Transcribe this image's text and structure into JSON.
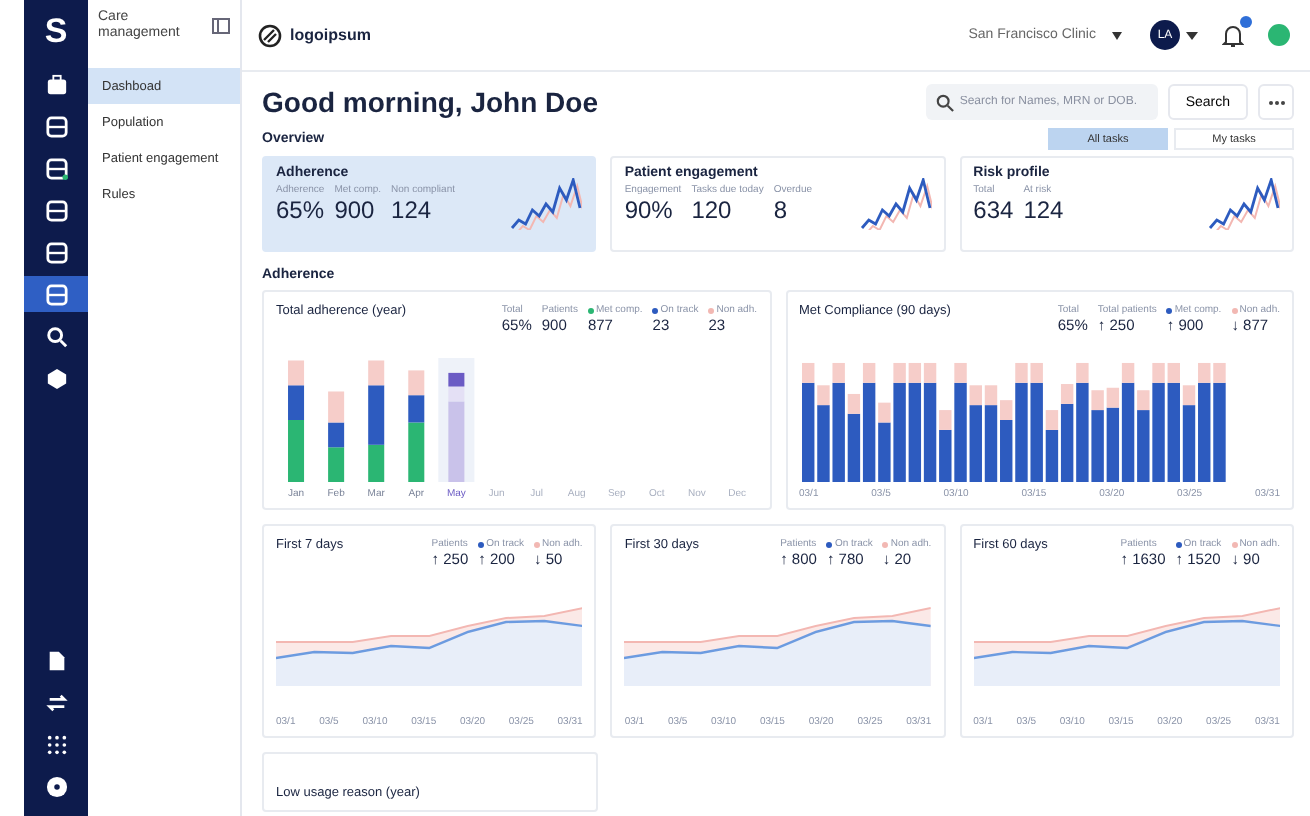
{
  "rail": {
    "logo": "S",
    "top_items": [
      {
        "selected": false
      },
      {
        "selected": false
      },
      {
        "selected": false
      },
      {
        "selected": false
      },
      {
        "selected": false
      },
      {
        "selected": true
      },
      {
        "selected": false
      },
      {
        "selected": false
      }
    ]
  },
  "nav": {
    "title": "Care management",
    "items": [
      {
        "label": "Dashboad",
        "selected": true
      },
      {
        "label": "Population",
        "selected": false
      },
      {
        "label": "Patient engagement",
        "selected": false
      },
      {
        "label": "Rules",
        "selected": false
      }
    ]
  },
  "topbar": {
    "brand": "logoipsum",
    "clinic": "San Francisco Clinic",
    "avatar": "LA",
    "notification": true
  },
  "header": {
    "greeting": "Good morning, John Doe",
    "search_placeholder": "Search for Names, MRN or DOB.",
    "search_button": "Search"
  },
  "overview": {
    "label": "Overview",
    "tabs": [
      {
        "label": "All tasks",
        "selected": true
      },
      {
        "label": "My tasks",
        "selected": false
      }
    ],
    "cards": [
      {
        "title": "Adherence",
        "selected": true,
        "stats": [
          {
            "label": "Adherence",
            "value": "65%"
          },
          {
            "label": "Met comp.",
            "value": "900"
          },
          {
            "label": "Non compliant",
            "value": "124"
          }
        ]
      },
      {
        "title": "Patient engagement",
        "selected": false,
        "stats": [
          {
            "label": "Engagement",
            "value": "90%"
          },
          {
            "label": "Tasks due today",
            "value": "120"
          },
          {
            "label": "Overdue",
            "value": "8"
          }
        ]
      },
      {
        "title": "Risk profile",
        "selected": false,
        "stats": [
          {
            "label": "Total",
            "value": "634"
          },
          {
            "label": "At risk",
            "value": "124"
          }
        ]
      }
    ]
  },
  "adherence": {
    "label": "Adherence",
    "total_chart": {
      "title": "Total adherence (year)",
      "stats": [
        {
          "label": "Total",
          "value": "65%"
        },
        {
          "label": "Patients",
          "value": "900"
        },
        {
          "label": "Met comp.",
          "value": "877",
          "color": "#2bb673"
        },
        {
          "label": "On track",
          "value": "23",
          "color": "#2d5bbf"
        },
        {
          "label": "Non adh.",
          "value": "23",
          "color": "#f2b8b3"
        }
      ],
      "months": [
        {
          "label": "Jan",
          "faded": false,
          "selected": false
        },
        {
          "label": "Feb",
          "faded": false,
          "selected": false
        },
        {
          "label": "Mar",
          "faded": false,
          "selected": false
        },
        {
          "label": "Apr",
          "faded": false,
          "selected": false
        },
        {
          "label": "May",
          "faded": false,
          "selected": true
        },
        {
          "label": "Jun",
          "faded": true,
          "selected": false
        },
        {
          "label": "Jul",
          "faded": true,
          "selected": false
        },
        {
          "label": "Aug",
          "faded": true,
          "selected": false
        },
        {
          "label": "Sep",
          "faded": true,
          "selected": false
        },
        {
          "label": "Oct",
          "faded": true,
          "selected": false
        },
        {
          "label": "Nov",
          "faded": true,
          "selected": false
        },
        {
          "label": "Dec",
          "faded": true,
          "selected": false
        }
      ]
    },
    "compliance_chart": {
      "title": "Met Compliance (90 days)",
      "stats": [
        {
          "label": "Total",
          "value": "65%"
        },
        {
          "label": "Total patients",
          "value": "↑ 250"
        },
        {
          "label": "Met comp.",
          "value": "↑ 900",
          "color": "#2d5bbf"
        },
        {
          "label": "Non adh.",
          "value": "↓ 877",
          "color": "#f2b8b3"
        }
      ],
      "dates": [
        "03/1",
        "03/5",
        "03/10",
        "03/15",
        "03/20",
        "03/25",
        "03/31"
      ]
    },
    "line_charts": [
      {
        "title": "First 7 days",
        "stats": [
          {
            "label": "Patients",
            "value": "↑ 250"
          },
          {
            "label": "On track",
            "value": "↑ 200",
            "color": "#2d5bbf"
          },
          {
            "label": "Non adh.",
            "value": "↓ 50",
            "color": "#f2b8b3"
          }
        ],
        "dates": [
          "03/1",
          "03/5",
          "03/10",
          "03/15",
          "03/20",
          "03/25",
          "03/31"
        ]
      },
      {
        "title": "First 30 days",
        "stats": [
          {
            "label": "Patients",
            "value": "↑ 800"
          },
          {
            "label": "On track",
            "value": "↑ 780",
            "color": "#2d5bbf"
          },
          {
            "label": "Non adh.",
            "value": "↓ 20",
            "color": "#f2b8b3"
          }
        ],
        "dates": [
          "03/1",
          "03/5",
          "03/10",
          "03/15",
          "03/20",
          "03/25",
          "03/31"
        ]
      },
      {
        "title": "First 60 days",
        "stats": [
          {
            "label": "Patients",
            "value": "↑ 1630"
          },
          {
            "label": "On track",
            "value": "↑ 1520",
            "color": "#2d5bbf"
          },
          {
            "label": "Non adh.",
            "value": "↓ 90",
            "color": "#f2b8b3"
          }
        ],
        "dates": [
          "03/1",
          "03/5",
          "03/10",
          "03/15",
          "03/20",
          "03/25",
          "03/31"
        ]
      }
    ],
    "low_usage": {
      "title": "Low usage reason (year)"
    }
  }
}
